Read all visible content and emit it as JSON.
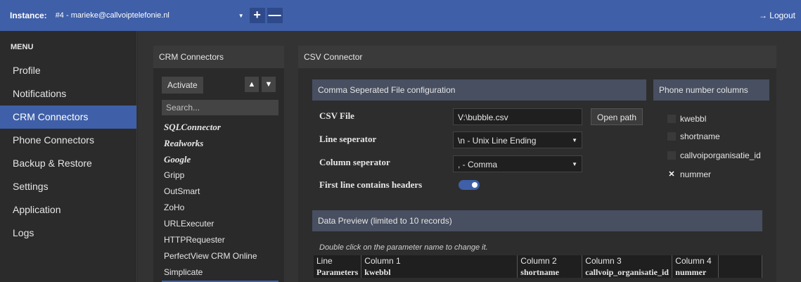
{
  "topbar": {
    "instance_label": "Instance:",
    "instance_value": "#4 - marieke@callvoiptelefonie.nl",
    "add_symbol": "+",
    "remove_symbol": "—",
    "logout_label": "→ Logout"
  },
  "sidebar": {
    "title": "MENU",
    "items": [
      {
        "label": "Profile"
      },
      {
        "label": "Notifications"
      },
      {
        "label": "CRM Connectors"
      },
      {
        "label": "Phone Connectors"
      },
      {
        "label": "Backup & Restore"
      },
      {
        "label": "Settings"
      },
      {
        "label": "Application"
      },
      {
        "label": "Logs"
      }
    ],
    "active_item": "CRM Connectors"
  },
  "crm_panel": {
    "title": "CRM Connectors",
    "activate_label": "Activate",
    "up_symbol": "▲",
    "down_symbol": "▼",
    "search_placeholder": "Search...",
    "items": [
      {
        "label": "SQLConnector"
      },
      {
        "label": "Realworks"
      },
      {
        "label": "Google"
      },
      {
        "label": "Gripp"
      },
      {
        "label": "OutSmart"
      },
      {
        "label": "ZoHo"
      },
      {
        "label": "URLExecuter"
      },
      {
        "label": "HTTPRequester"
      },
      {
        "label": "PerfectView CRM Online"
      },
      {
        "label": "Simplicate"
      }
    ]
  },
  "csv_panel": {
    "title": "CSV Connector",
    "config_title": "Comma Seperated File configuration",
    "csv_file_label": "CSV File",
    "csv_file_value": "V:\\bubble.csv",
    "open_path_label": "Open path",
    "line_sep_label": "Line seperator",
    "line_sep_value": "\\n - Unix Line Ending",
    "col_sep_label": "Column seperator",
    "col_sep_value": ", - Comma",
    "headers_label": "First line contains headers",
    "headers_enabled": true,
    "phone_columns_title": "Phone number columns",
    "phone_columns": [
      {
        "label": "kwebbl",
        "checked": false
      },
      {
        "label": "shortname",
        "checked": false
      },
      {
        "label": "callvoiporganisatie_id",
        "checked": false
      },
      {
        "label": "nummer",
        "checked": true
      }
    ],
    "checked_mark": "✕",
    "preview_title": "Data Preview (limited to 10 records)",
    "preview_hint": "Double click on the parameter name to change it.",
    "preview_headers": [
      "Line",
      "Column 1",
      "Column 2",
      "Column 3",
      "Column 4"
    ],
    "preview_params": [
      "Parameters",
      "kwebbl",
      "shortname",
      "callvoip_organisatie_id",
      "nummer"
    ]
  }
}
